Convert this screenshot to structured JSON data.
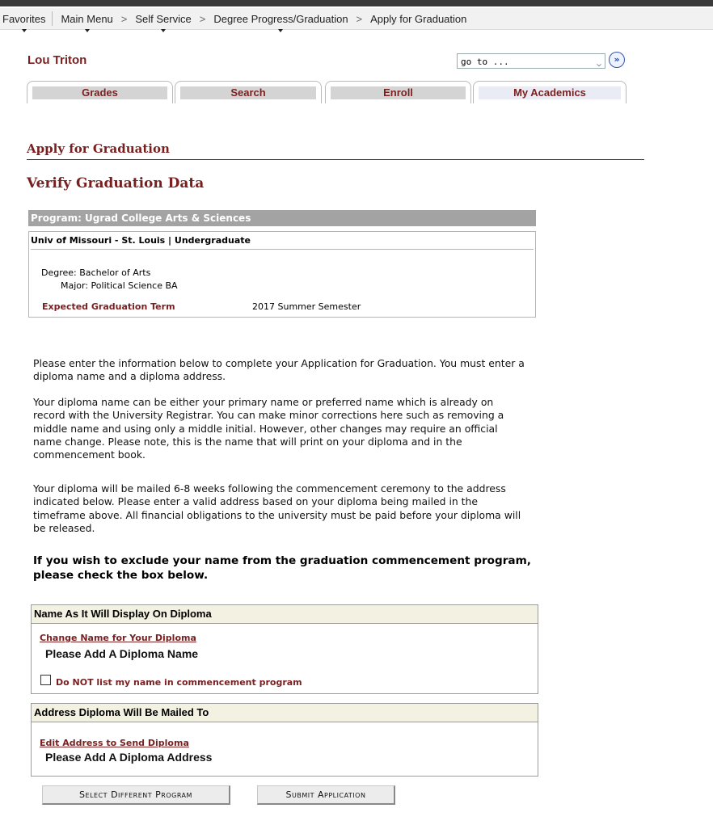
{
  "breadcrumb": {
    "items": [
      "Favorites",
      "Main Menu",
      "Self Service",
      "Degree Progress/Graduation",
      "Apply for Graduation"
    ],
    "separator": ">"
  },
  "student": {
    "name": "Lou Triton"
  },
  "goto": {
    "value": "go to ...",
    "button_glyph": "»"
  },
  "tabs": [
    "Grades",
    "Search",
    "Enroll",
    "My Academics"
  ],
  "active_tab": "My Academics",
  "page_title": "Apply for Graduation",
  "section_title": "Verify Graduation Data",
  "program": {
    "header": "Program: Ugrad College Arts & Sciences",
    "institution": "Univ of Missouri - St. Louis | Undergraduate",
    "degree": "Degree: Bachelor of Arts",
    "major": "Major: Political Science BA",
    "expected_term_label": "Expected Graduation Term",
    "expected_term_value": "2017 Summer Semester"
  },
  "instructions": [
    "Please enter the information below to complete your Application for Graduation. You must enter a diploma name and a diploma address.",
    "Your diploma name can be either your primary name or preferred name which is already on record with the University Registrar. You can make minor corrections here such as removing a middle name and using only a middle initial. However, other changes may require an official name change. Please note, this is the name that will print on your diploma and in the commencement book.",
    "Your diploma will be mailed 6-8 weeks following the commencement ceremony to the address indicated below. Please enter a valid address based on your diploma being mailed in the timeframe above. All financial obligations to the university must be paid before your diploma will be released."
  ],
  "exclude_notice": "If you wish to exclude your name from the graduation commencement program, please check the box below.",
  "diploma_name": {
    "header": "Name As It Will Display On Diploma",
    "link": "Change Name for Your Diploma",
    "value": "Please Add A Diploma Name",
    "checkbox_label": "Do NOT list my name in commencement program",
    "checkbox_checked": false
  },
  "diploma_address": {
    "header": "Address Diploma Will Be Mailed To",
    "link": "Edit Address to Send Diploma",
    "value": "Please Add A Diploma Address"
  },
  "buttons": {
    "select_program": "Select Different Program",
    "submit": "Submit Application"
  }
}
